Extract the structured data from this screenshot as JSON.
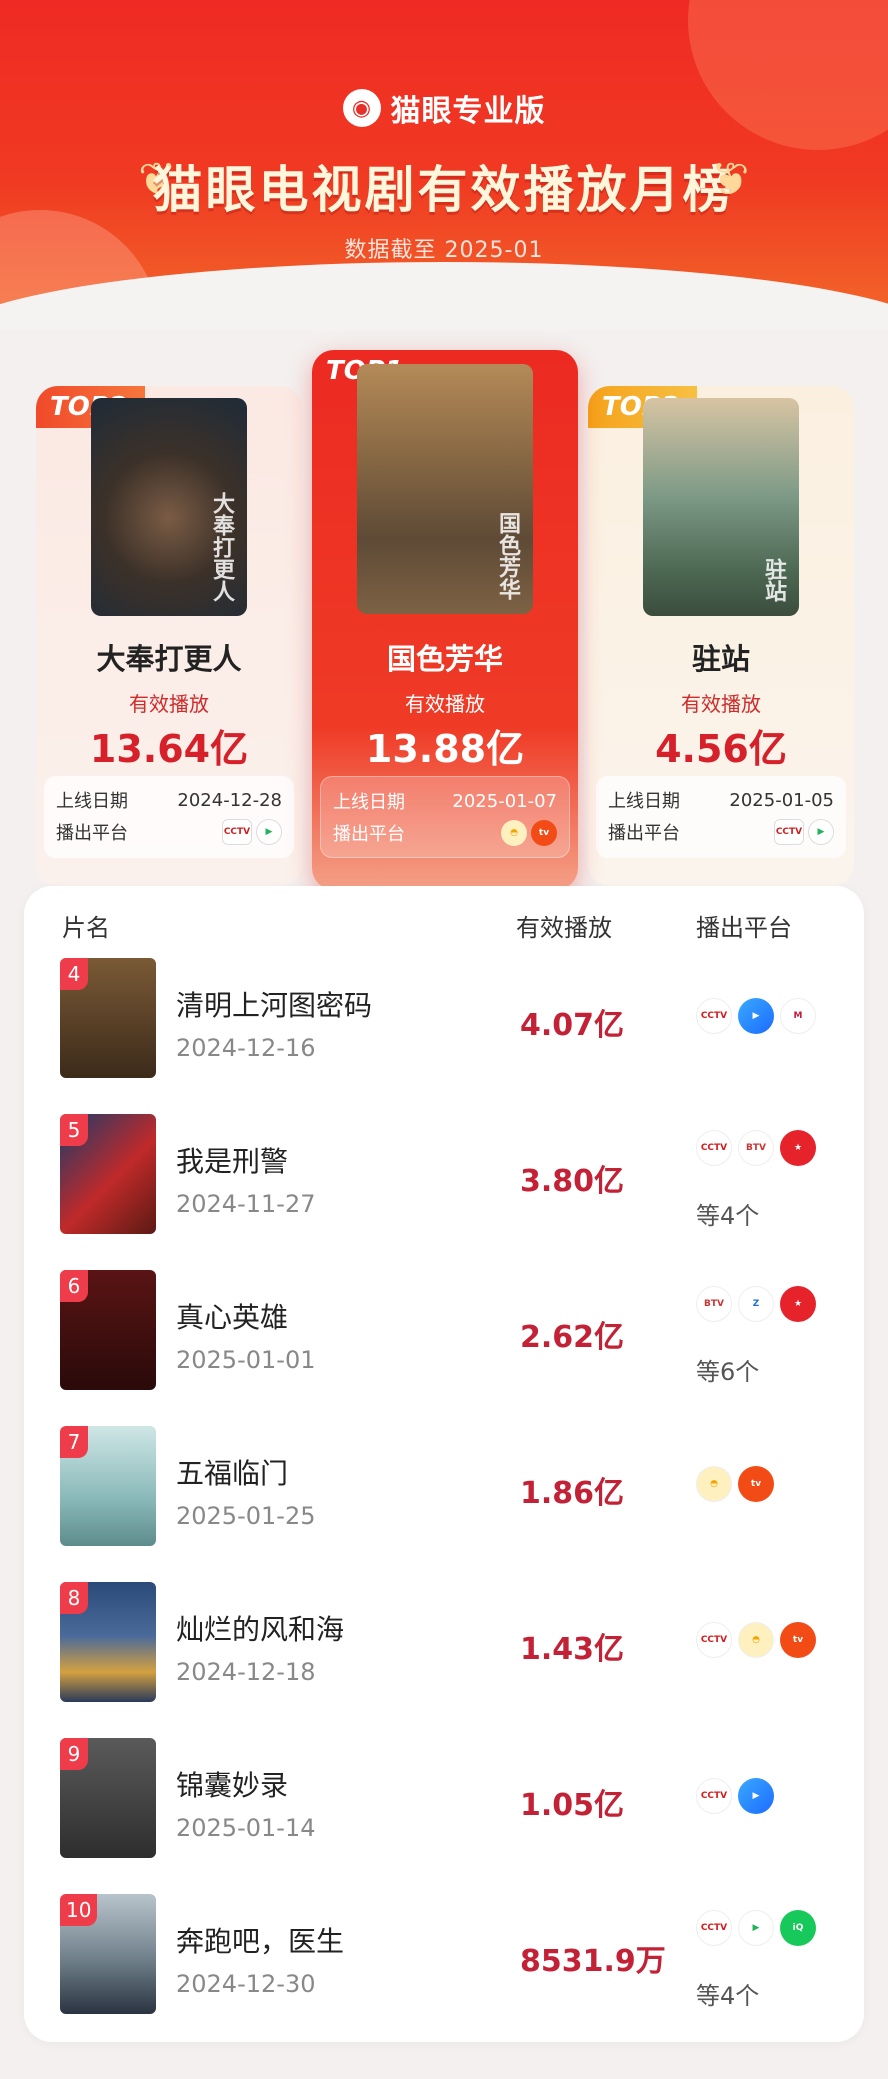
{
  "header": {
    "brand": "猫眼专业版",
    "title": "猫眼电视剧有效播放月榜",
    "subtitle": "数据截至 2025-01"
  },
  "top3": [
    {
      "rank_label": "TOP2",
      "name": "大奉打更人",
      "plays_label": "有效播放",
      "plays": "13.64亿",
      "date_label": "上线日期",
      "date": "2024-12-28",
      "platform_label": "播出平台",
      "platforms": [
        "cctv8-icon",
        "tencent-video-icon"
      ],
      "poster_text": "大奉打更人"
    },
    {
      "rank_label": "TOP1",
      "name": "国色芳华",
      "plays_label": "有效播放",
      "plays": "13.88亿",
      "date_label": "上线日期",
      "date": "2025-01-07",
      "platform_label": "播出平台",
      "platforms": [
        "mango-tv-icon",
        "mangotv-red-icon"
      ],
      "poster_text": "国色芳华"
    },
    {
      "rank_label": "TOP3",
      "name": "驻站",
      "plays_label": "有效播放",
      "plays": "4.56亿",
      "date_label": "上线日期",
      "date": "2025-01-05",
      "platform_label": "播出平台",
      "platforms": [
        "cctv8-icon",
        "tencent-video-icon"
      ],
      "poster_text": "驻站"
    }
  ],
  "list": {
    "headers": {
      "name": "片名",
      "plays": "有效播放",
      "platform": "播出平台"
    },
    "rows": [
      {
        "rank": "4",
        "title": "清明上河图密码",
        "date": "2024-12-16",
        "plays": "4.07亿",
        "platforms": [
          "cctv8-icon",
          "youku-icon",
          "migu-icon"
        ],
        "more": ""
      },
      {
        "rank": "5",
        "title": "我是刑警",
        "date": "2024-11-27",
        "plays": "3.80亿",
        "platforms": [
          "cctv1-icon",
          "btv-icon",
          "red-star-icon"
        ],
        "more": "等4个"
      },
      {
        "rank": "6",
        "title": "真心英雄",
        "date": "2025-01-01",
        "plays": "2.62亿",
        "platforms": [
          "btv-icon",
          "zhejiang-tv-icon",
          "red-star-icon"
        ],
        "more": "等6个"
      },
      {
        "rank": "7",
        "title": "五福临门",
        "date": "2025-01-25",
        "plays": "1.86亿",
        "platforms": [
          "mango-tv-icon",
          "mangotv-red-icon"
        ],
        "more": ""
      },
      {
        "rank": "8",
        "title": "灿烂的风和海",
        "date": "2024-12-18",
        "plays": "1.43亿",
        "platforms": [
          "cctv1-icon",
          "mango-tv-icon",
          "mangotv-red-icon"
        ],
        "more": ""
      },
      {
        "rank": "9",
        "title": "锦囊妙录",
        "date": "2025-01-14",
        "plays": "1.05亿",
        "platforms": [
          "cctv8-icon",
          "youku-icon"
        ],
        "more": ""
      },
      {
        "rank": "10",
        "title": "奔跑吧，医生",
        "date": "2024-12-30",
        "plays": "8531.9万",
        "platforms": [
          "cctv8-icon",
          "tencent-video-icon",
          "iqiyi-icon"
        ],
        "more": "等4个"
      }
    ]
  },
  "colors": {
    "brand_red": "#ef2a24",
    "plays_red": "#c32236",
    "rank_badge": "#ef3c4a"
  }
}
